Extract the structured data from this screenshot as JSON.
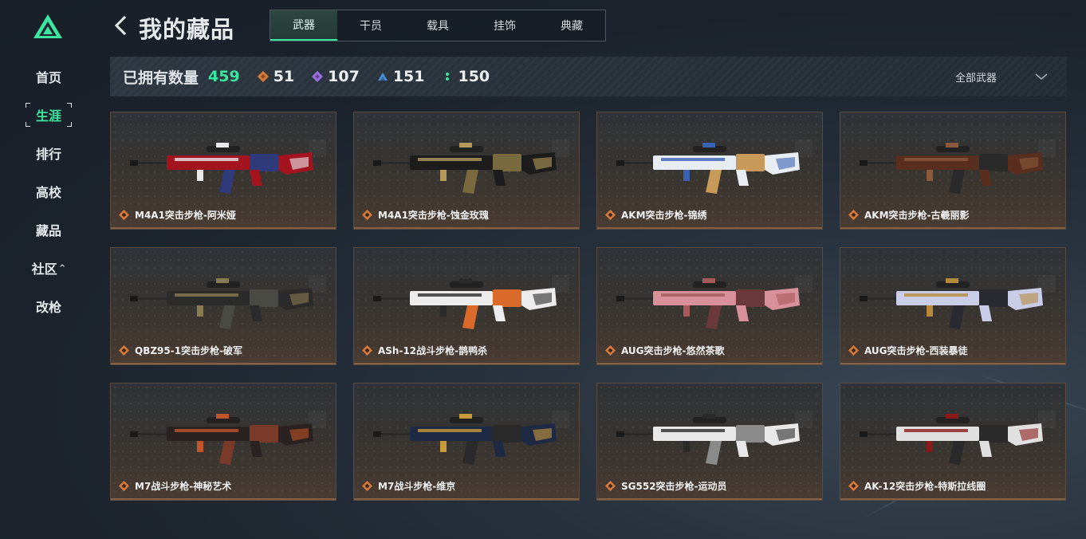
{
  "page": {
    "title": "我的藏品"
  },
  "sidebar": {
    "items": [
      {
        "label": "首页",
        "active": false
      },
      {
        "label": "生涯",
        "active": true
      },
      {
        "label": "排行",
        "active": false
      },
      {
        "label": "高校",
        "active": false
      },
      {
        "label": "藏品",
        "active": false
      },
      {
        "label": "社区",
        "active": false,
        "caret": "^"
      },
      {
        "label": "改枪",
        "active": false
      }
    ]
  },
  "tabs": [
    {
      "label": "武器",
      "active": true
    },
    {
      "label": "干员",
      "active": false
    },
    {
      "label": "载具",
      "active": false
    },
    {
      "label": "挂饰",
      "active": false
    },
    {
      "label": "典藏",
      "active": false
    }
  ],
  "stats": {
    "owned_label": "已拥有数量",
    "owned_count": "459",
    "rarities": [
      {
        "icon": "orange-diamond-icon",
        "color": "#d97a3a",
        "count": "51"
      },
      {
        "icon": "purple-diamond-icon",
        "color": "#9b6ee0",
        "count": "107"
      },
      {
        "icon": "blue-triangle-icon",
        "color": "#4a8fd8",
        "count": "151"
      },
      {
        "icon": "green-dots-icon",
        "color": "#3be6a1",
        "count": "150"
      }
    ],
    "filter_label": "全部武器"
  },
  "colors": {
    "accent": "#3be6a1",
    "quality_orange": "#d97a3a"
  },
  "items": [
    {
      "name": "M4A1突击步枪-阿米娅",
      "skin": [
        "#a3141e",
        "#e9e9ee",
        "#2f3a7a"
      ]
    },
    {
      "name": "M4A1突击步枪-蚀金玫瑰",
      "skin": [
        "#1c1c1c",
        "#b59a5a",
        "#7a6a40"
      ]
    },
    {
      "name": "AKM突击步枪-锦绣",
      "skin": [
        "#e8ecf3",
        "#3a62b3",
        "#c79a5a"
      ]
    },
    {
      "name": "AKM突击步枪-古羲丽影",
      "skin": [
        "#5a2e1e",
        "#8b5a3c",
        "#2a2a2a"
      ]
    },
    {
      "name": "QBZ95-1突击步枪-破军",
      "skin": [
        "#2b2b2b",
        "#8a7a50",
        "#4a4a44"
      ]
    },
    {
      "name": "ASh-12战斗步枪-鹊鸭杀",
      "skin": [
        "#ececec",
        "#2a2a2a",
        "#d96a2a"
      ]
    },
    {
      "name": "AUG突击步枪-悠然茶歌",
      "skin": [
        "#d8909a",
        "#a85a5a",
        "#6a3a3a"
      ]
    },
    {
      "name": "AUG突击步枪-西装暴徒",
      "skin": [
        "#c9cde8",
        "#b8893a",
        "#2a2a33"
      ]
    },
    {
      "name": "M7战斗步枪-神秘艺术",
      "skin": [
        "#2a2220",
        "#c0542a",
        "#7a3a2a"
      ]
    },
    {
      "name": "M7战斗步枪-维京",
      "skin": [
        "#1e2a44",
        "#c99a3a",
        "#2a2a2a"
      ]
    },
    {
      "name": "SG552突击步枪-运动员",
      "skin": [
        "#e8e8e8",
        "#2a2a2a",
        "#8a8a8a"
      ]
    },
    {
      "name": "AK-12突击步枪-特斯拉线圈",
      "skin": [
        "#e0e0e0",
        "#8a1a1a",
        "#2a2a2a"
      ]
    }
  ]
}
